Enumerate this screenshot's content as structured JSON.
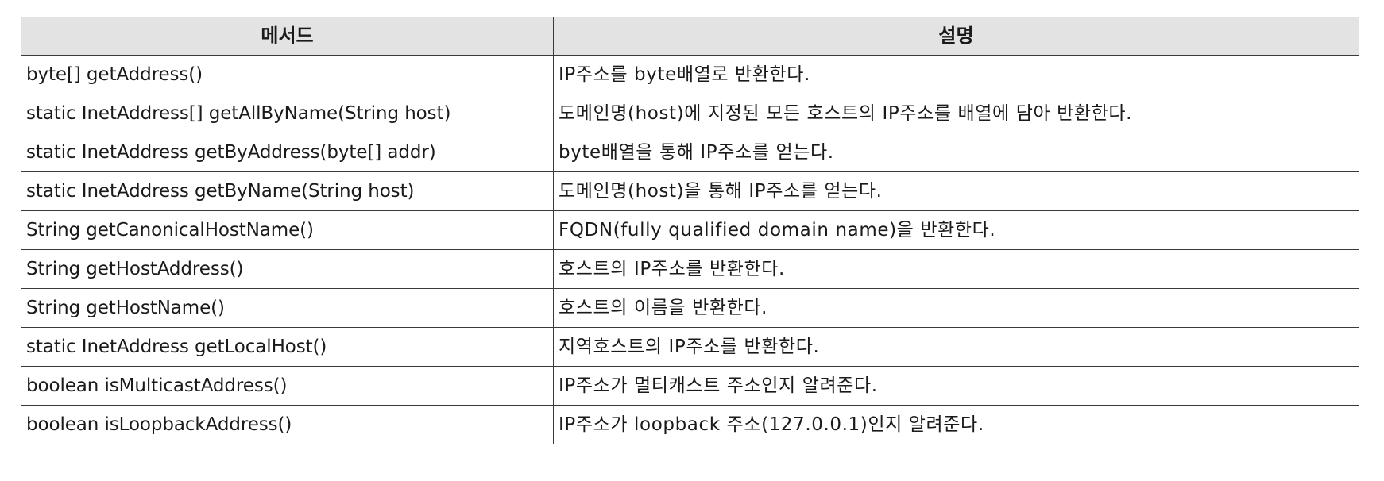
{
  "table": {
    "headers": [
      "메서드",
      "설명"
    ],
    "rows": [
      {
        "method": "byte[] getAddress()",
        "description": "IP주소를 byte배열로 반환한다."
      },
      {
        "method": "static InetAddress[] getAllByName(String host)",
        "description": "도메인명(host)에 지정된 모든 호스트의 IP주소를 배열에 담아 반환한다."
      },
      {
        "method": "static InetAddress getByAddress(byte[] addr)",
        "description": "byte배열을 통해 IP주소를 얻는다."
      },
      {
        "method": "static InetAddress getByName(String host)",
        "description": "도메인명(host)을 통해 IP주소를 얻는다."
      },
      {
        "method": "String getCanonicalHostName()",
        "description": "FQDN(fully qualified domain name)을 반환한다."
      },
      {
        "method": "String getHostAddress()",
        "description": "호스트의 IP주소를 반환한다."
      },
      {
        "method": "String getHostName()",
        "description": "호스트의 이름을 반환한다."
      },
      {
        "method": "static InetAddress getLocalHost()",
        "description": "지역호스트의 IP주소를 반환한다."
      },
      {
        "method": "boolean isMulticastAddress()",
        "description": "IP주소가 멀티캐스트 주소인지 알려준다."
      },
      {
        "method": "boolean isLoopbackAddress()",
        "description": "IP주소가 loopback 주소(127.0.0.1)인지 알려준다."
      }
    ]
  }
}
